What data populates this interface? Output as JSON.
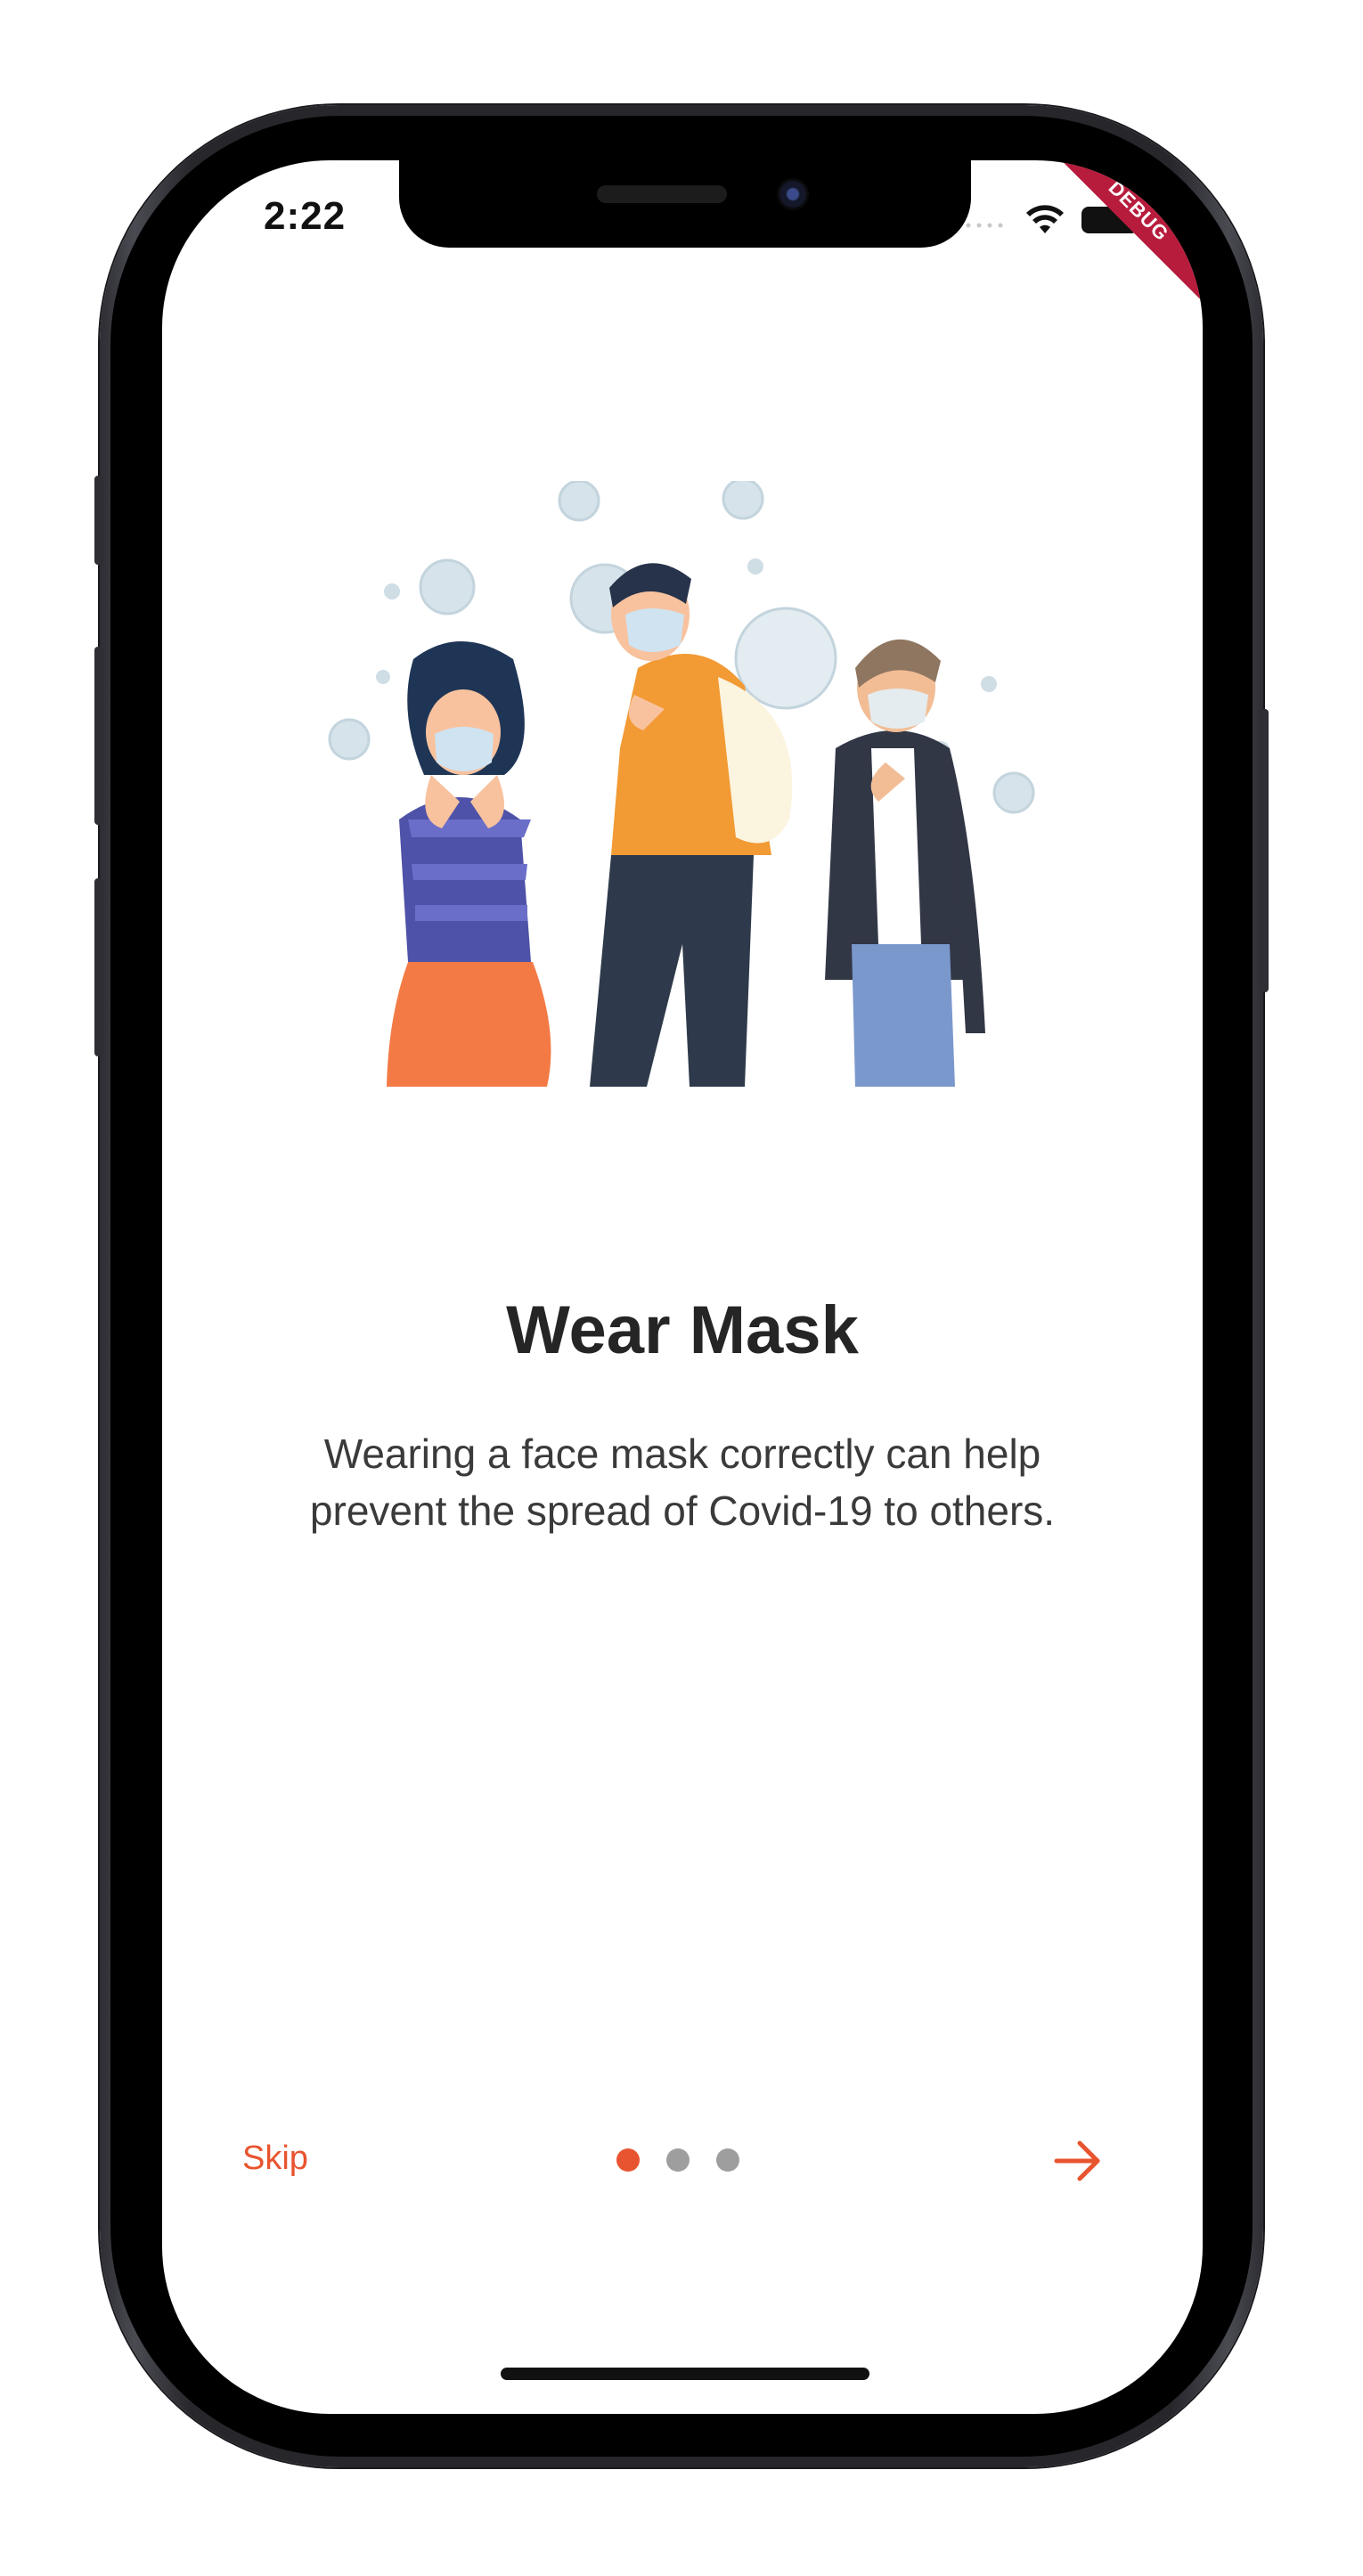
{
  "status_bar": {
    "time": "2:22",
    "debug_label": "DEBUG"
  },
  "onboarding": {
    "title": "Wear Mask",
    "description": "Wearing a face mask correctly can help prevent the spread of Covid-19 to others.",
    "skip_label": "Skip",
    "page_count": 3,
    "active_page": 1,
    "next_icon": "arrow-right-icon",
    "illustration_icon": "people-wearing-masks-illustration"
  },
  "colors": {
    "accent": "#e8542f",
    "inactive_dot": "#9e9e9e",
    "title_text": "#252525",
    "body_text": "#3a3a3a",
    "debug_banner": "#b71c3c"
  }
}
